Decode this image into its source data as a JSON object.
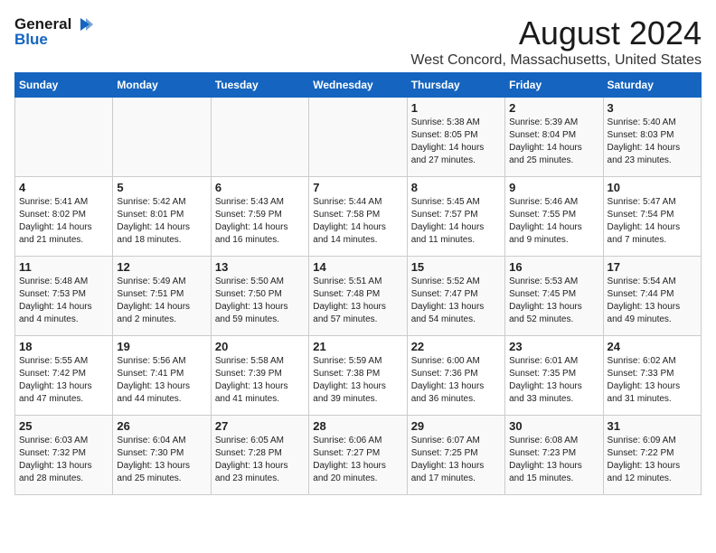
{
  "logo": {
    "line1": "General",
    "line2": "Blue"
  },
  "title": "August 2024",
  "subtitle": "West Concord, Massachusetts, United States",
  "columns": [
    "Sunday",
    "Monday",
    "Tuesday",
    "Wednesday",
    "Thursday",
    "Friday",
    "Saturday"
  ],
  "weeks": [
    [
      {
        "day": "",
        "info": ""
      },
      {
        "day": "",
        "info": ""
      },
      {
        "day": "",
        "info": ""
      },
      {
        "day": "",
        "info": ""
      },
      {
        "day": "1",
        "info": "Sunrise: 5:38 AM\nSunset: 8:05 PM\nDaylight: 14 hours\nand 27 minutes."
      },
      {
        "day": "2",
        "info": "Sunrise: 5:39 AM\nSunset: 8:04 PM\nDaylight: 14 hours\nand 25 minutes."
      },
      {
        "day": "3",
        "info": "Sunrise: 5:40 AM\nSunset: 8:03 PM\nDaylight: 14 hours\nand 23 minutes."
      }
    ],
    [
      {
        "day": "4",
        "info": "Sunrise: 5:41 AM\nSunset: 8:02 PM\nDaylight: 14 hours\nand 21 minutes."
      },
      {
        "day": "5",
        "info": "Sunrise: 5:42 AM\nSunset: 8:01 PM\nDaylight: 14 hours\nand 18 minutes."
      },
      {
        "day": "6",
        "info": "Sunrise: 5:43 AM\nSunset: 7:59 PM\nDaylight: 14 hours\nand 16 minutes."
      },
      {
        "day": "7",
        "info": "Sunrise: 5:44 AM\nSunset: 7:58 PM\nDaylight: 14 hours\nand 14 minutes."
      },
      {
        "day": "8",
        "info": "Sunrise: 5:45 AM\nSunset: 7:57 PM\nDaylight: 14 hours\nand 11 minutes."
      },
      {
        "day": "9",
        "info": "Sunrise: 5:46 AM\nSunset: 7:55 PM\nDaylight: 14 hours\nand 9 minutes."
      },
      {
        "day": "10",
        "info": "Sunrise: 5:47 AM\nSunset: 7:54 PM\nDaylight: 14 hours\nand 7 minutes."
      }
    ],
    [
      {
        "day": "11",
        "info": "Sunrise: 5:48 AM\nSunset: 7:53 PM\nDaylight: 14 hours\nand 4 minutes."
      },
      {
        "day": "12",
        "info": "Sunrise: 5:49 AM\nSunset: 7:51 PM\nDaylight: 14 hours\nand 2 minutes."
      },
      {
        "day": "13",
        "info": "Sunrise: 5:50 AM\nSunset: 7:50 PM\nDaylight: 13 hours\nand 59 minutes."
      },
      {
        "day": "14",
        "info": "Sunrise: 5:51 AM\nSunset: 7:48 PM\nDaylight: 13 hours\nand 57 minutes."
      },
      {
        "day": "15",
        "info": "Sunrise: 5:52 AM\nSunset: 7:47 PM\nDaylight: 13 hours\nand 54 minutes."
      },
      {
        "day": "16",
        "info": "Sunrise: 5:53 AM\nSunset: 7:45 PM\nDaylight: 13 hours\nand 52 minutes."
      },
      {
        "day": "17",
        "info": "Sunrise: 5:54 AM\nSunset: 7:44 PM\nDaylight: 13 hours\nand 49 minutes."
      }
    ],
    [
      {
        "day": "18",
        "info": "Sunrise: 5:55 AM\nSunset: 7:42 PM\nDaylight: 13 hours\nand 47 minutes."
      },
      {
        "day": "19",
        "info": "Sunrise: 5:56 AM\nSunset: 7:41 PM\nDaylight: 13 hours\nand 44 minutes."
      },
      {
        "day": "20",
        "info": "Sunrise: 5:58 AM\nSunset: 7:39 PM\nDaylight: 13 hours\nand 41 minutes."
      },
      {
        "day": "21",
        "info": "Sunrise: 5:59 AM\nSunset: 7:38 PM\nDaylight: 13 hours\nand 39 minutes."
      },
      {
        "day": "22",
        "info": "Sunrise: 6:00 AM\nSunset: 7:36 PM\nDaylight: 13 hours\nand 36 minutes."
      },
      {
        "day": "23",
        "info": "Sunrise: 6:01 AM\nSunset: 7:35 PM\nDaylight: 13 hours\nand 33 minutes."
      },
      {
        "day": "24",
        "info": "Sunrise: 6:02 AM\nSunset: 7:33 PM\nDaylight: 13 hours\nand 31 minutes."
      }
    ],
    [
      {
        "day": "25",
        "info": "Sunrise: 6:03 AM\nSunset: 7:32 PM\nDaylight: 13 hours\nand 28 minutes."
      },
      {
        "day": "26",
        "info": "Sunrise: 6:04 AM\nSunset: 7:30 PM\nDaylight: 13 hours\nand 25 minutes."
      },
      {
        "day": "27",
        "info": "Sunrise: 6:05 AM\nSunset: 7:28 PM\nDaylight: 13 hours\nand 23 minutes."
      },
      {
        "day": "28",
        "info": "Sunrise: 6:06 AM\nSunset: 7:27 PM\nDaylight: 13 hours\nand 20 minutes."
      },
      {
        "day": "29",
        "info": "Sunrise: 6:07 AM\nSunset: 7:25 PM\nDaylight: 13 hours\nand 17 minutes."
      },
      {
        "day": "30",
        "info": "Sunrise: 6:08 AM\nSunset: 7:23 PM\nDaylight: 13 hours\nand 15 minutes."
      },
      {
        "day": "31",
        "info": "Sunrise: 6:09 AM\nSunset: 7:22 PM\nDaylight: 13 hours\nand 12 minutes."
      }
    ]
  ]
}
